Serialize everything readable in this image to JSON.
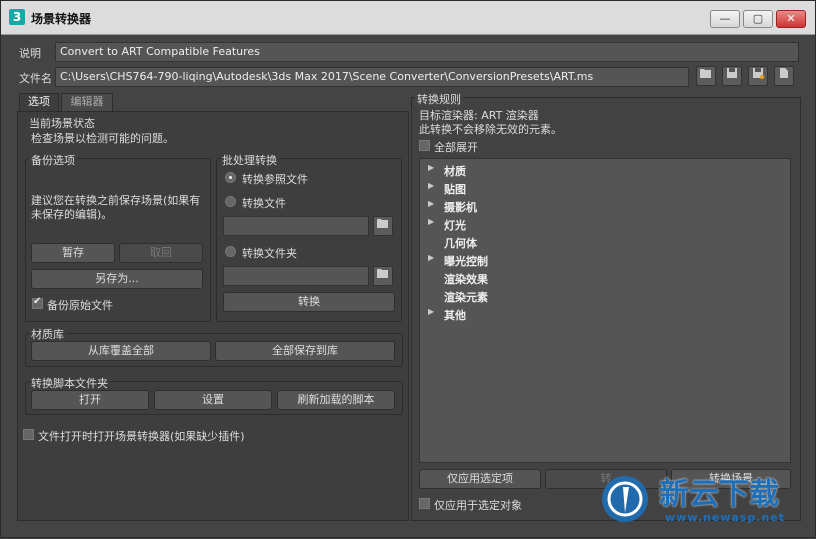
{
  "window": {
    "title": "场景转换器",
    "app_icon": "3",
    "controls": {
      "minimize": "—",
      "maximize": "▢",
      "close": "✕"
    }
  },
  "description": {
    "label": "说明",
    "value": "Convert to ART Compatible Features"
  },
  "filename": {
    "label": "文件名",
    "value": "C:\\Users\\CHS764-790-liqing\\Autodesk\\3ds Max 2017\\Scene Converter\\ConversionPresets\\ART.ms"
  },
  "tabs": [
    {
      "label": "选项"
    },
    {
      "label": "编辑器"
    }
  ],
  "scene_status": {
    "title": "当前场景状态",
    "text": "检查场景以检测可能的问题。"
  },
  "backup": {
    "title": "备份选项",
    "advice_line1": "建议您在转换之前保存场景(如果有",
    "advice_line2": "未保存的编辑)。",
    "save_button": "暂存",
    "restore_button": "取回",
    "save_as_button": "另存为...",
    "backup_original_label": "备份原始文件",
    "backup_original_checked": true
  },
  "batch": {
    "title": "批处理转换",
    "convert_refs_label": "转换参照文件",
    "convert_file_label": "转换文件",
    "convert_folder_label": "转换文件夹",
    "convert_button": "转换",
    "selected": "convert_refs"
  },
  "material_library": {
    "title": "材质库",
    "overwrite_button": "从库覆盖全部",
    "save_all_button": "全部保存到库"
  },
  "script_folder": {
    "title": "转换脚本文件夹",
    "open_button": "打开",
    "settings_button": "设置",
    "refresh_button": "刷新加载的脚本"
  },
  "open_on_load_label": "文件打开时打开场景转换器(如果缺少插件)",
  "rules": {
    "title": "转换规则",
    "target_renderer": "目标渲染器: ART 渲染器",
    "note": "此转换不会移除无效的元素。",
    "expand_all_label": "全部展开",
    "items": [
      {
        "label": "材质",
        "has_children": true
      },
      {
        "label": "贴图",
        "has_children": true
      },
      {
        "label": "摄影机",
        "has_children": true
      },
      {
        "label": "灯光",
        "has_children": true
      },
      {
        "label": "几何体",
        "has_children": false
      },
      {
        "label": "曝光控制",
        "has_children": true
      },
      {
        "label": "渲染效果",
        "has_children": false
      },
      {
        "label": "渲染元素",
        "has_children": false
      },
      {
        "label": "其他",
        "has_children": true
      }
    ],
    "apply_selected_button": "仅应用选定项",
    "apply_all_button": "转",
    "third_button": "转换场景",
    "selected_only_label": "仅应用于选定对象"
  },
  "watermark": {
    "brand": "新云下载",
    "url": "www.newasp.net"
  },
  "colors": {
    "accent": "#1aa7a7",
    "bg": "#444444",
    "field": "#555555"
  }
}
